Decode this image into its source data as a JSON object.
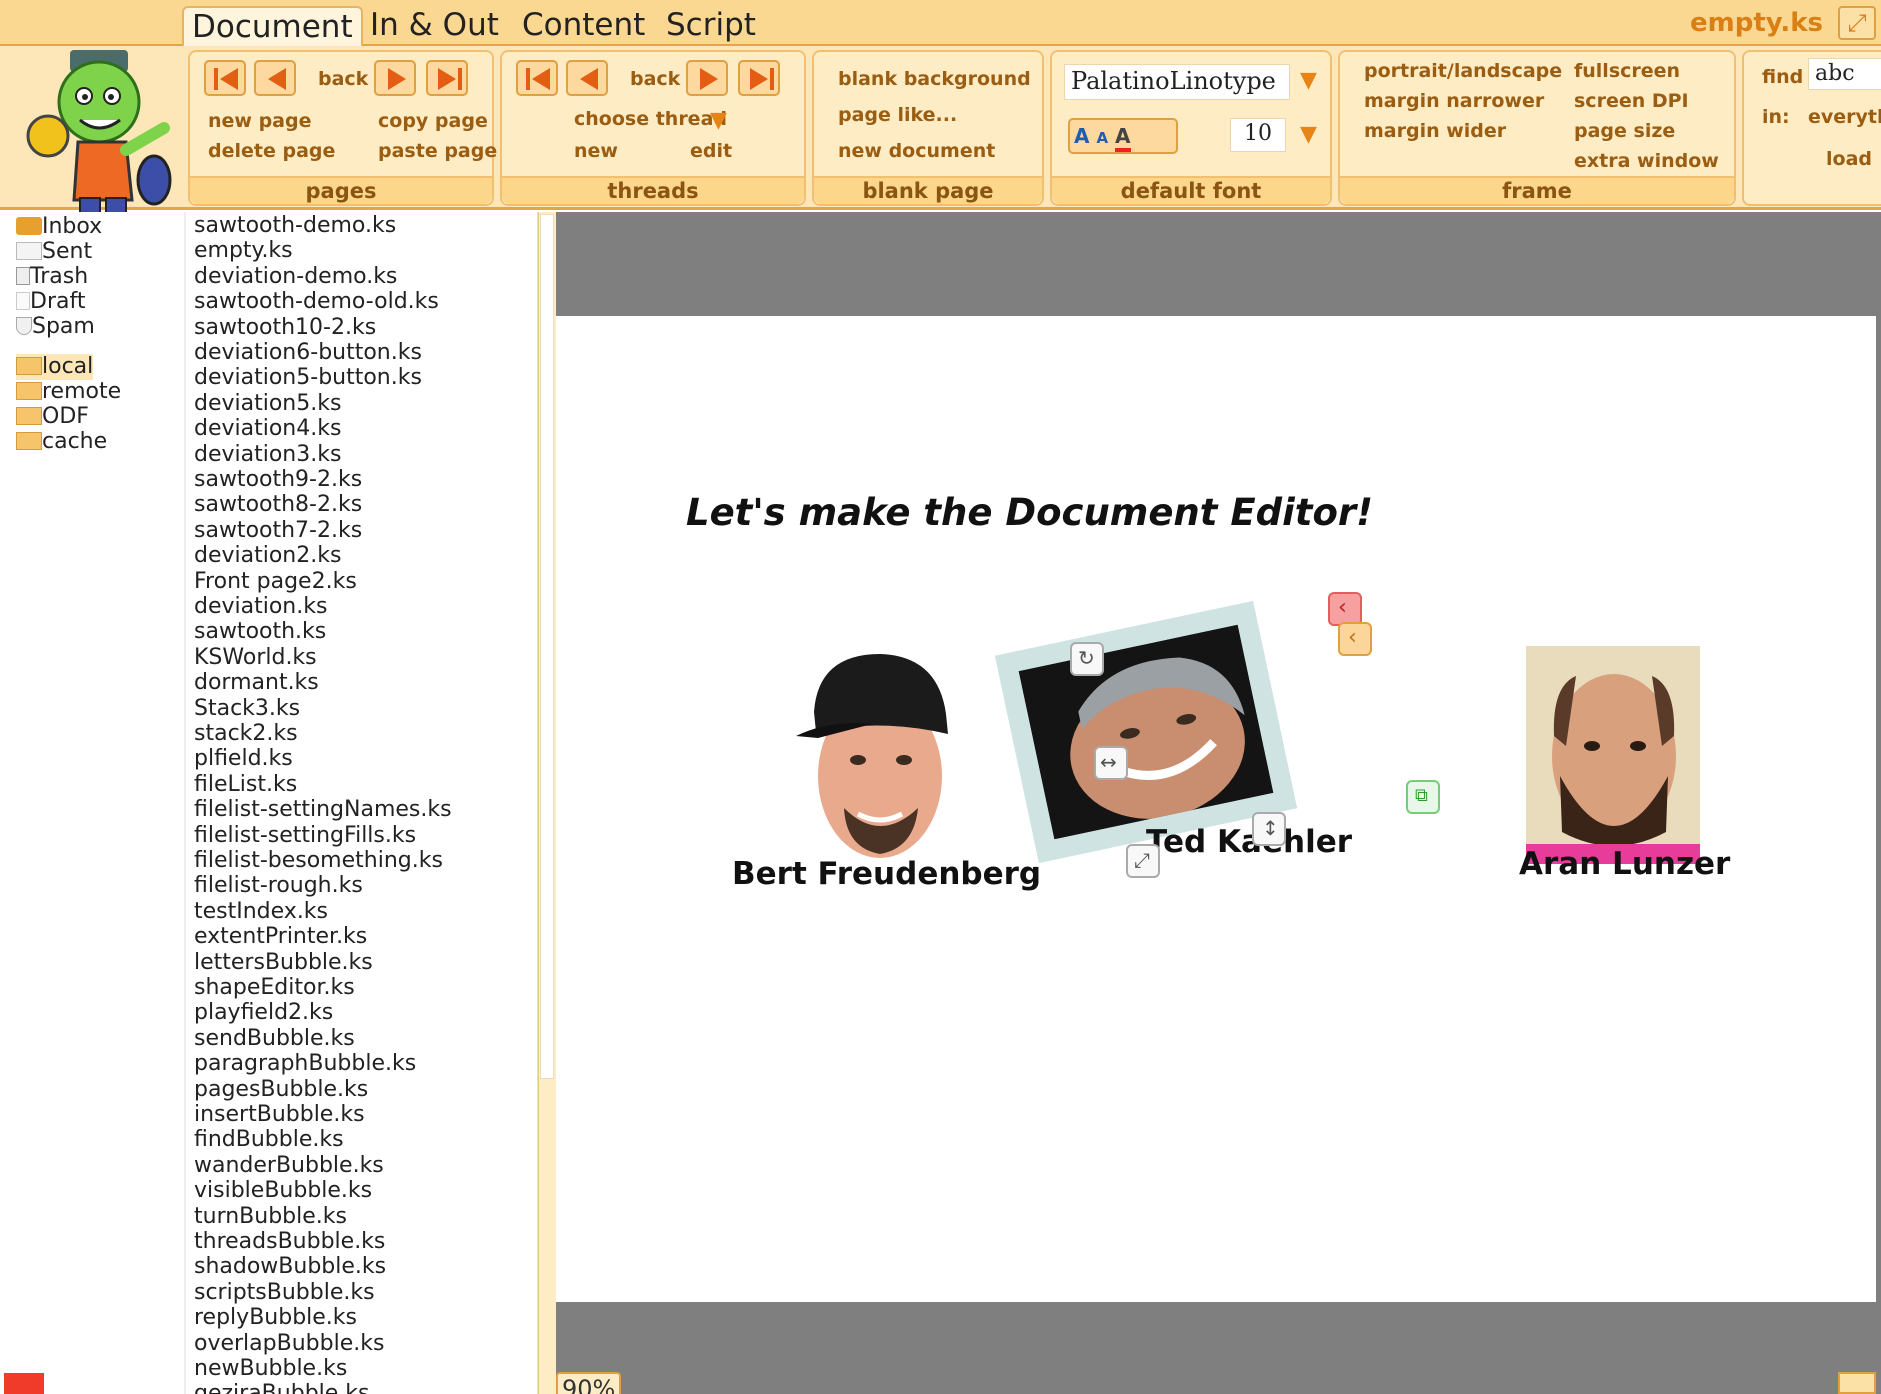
{
  "tabs": {
    "document": "Document",
    "inout": "In & Out",
    "content": "Content",
    "script": "Script"
  },
  "doc_title": "empty.ks",
  "pages_group": {
    "back": "back",
    "new_page": "new page",
    "copy_page": "copy page",
    "delete_page": "delete page",
    "paste_page": "paste page",
    "label": "pages"
  },
  "threads_group": {
    "back": "back",
    "choose_thread": "choose thread",
    "new": "new",
    "edit": "edit",
    "label": "threads"
  },
  "blank_group": {
    "blank_background": "blank background",
    "page_like": "page like...",
    "new_document": "new document",
    "label": "blank page"
  },
  "font_group": {
    "font_name": "PalatinoLinotype",
    "font_size": "10",
    "label": "default font"
  },
  "frame_group": {
    "portrait_landscape": "portrait/landscape",
    "margin_narrower": "margin narrower",
    "margin_wider": "margin wider",
    "fullscreen": "fullscreen",
    "screen_dpi": "screen DPI",
    "page_size": "page size",
    "extra_window": "extra window",
    "label": "frame"
  },
  "find_group": {
    "find": "find",
    "find_value": "abc",
    "in": "in:",
    "scope": "everyth",
    "load": "load"
  },
  "mailboxes": [
    "Inbox",
    "Sent",
    "Trash",
    "Draft",
    "Spam"
  ],
  "folders": [
    "local",
    "remote",
    "ODF",
    "cache"
  ],
  "files": [
    "sawtooth-demo.ks",
    "empty.ks",
    "deviation-demo.ks",
    "sawtooth-demo-old.ks",
    "sawtooth10-2.ks",
    "deviation6-button.ks",
    "deviation5-button.ks",
    "deviation5.ks",
    "deviation4.ks",
    "deviation3.ks",
    "sawtooth9-2.ks",
    "sawtooth8-2.ks",
    "sawtooth7-2.ks",
    "deviation2.ks",
    "Front page2.ks",
    "deviation.ks",
    "sawtooth.ks",
    "KSWorld.ks",
    "dormant.ks",
    "Stack3.ks",
    "stack2.ks",
    "plfield.ks",
    "fileList.ks",
    "filelist-settingNames.ks",
    "filelist-settingFills.ks",
    "filelist-besomething.ks",
    "filelist-rough.ks",
    "testIndex.ks",
    "extentPrinter.ks",
    "lettersBubble.ks",
    "shapeEditor.ks",
    "playfield2.ks",
    "sendBubble.ks",
    "paragraphBubble.ks",
    "pagesBubble.ks",
    "insertBubble.ks",
    "findBubble.ks",
    "wanderBubble.ks",
    "visibleBubble.ks",
    "turnBubble.ks",
    "threadsBubble.ks",
    "shadowBubble.ks",
    "scriptsBubble.ks",
    "replyBubble.ks",
    "overlapBubble.ks",
    "newBubble.ks",
    "geziraBubble.ks"
  ],
  "document": {
    "heading": "Let's make the Document Editor!",
    "people": [
      "Bert Freudenberg",
      "Ted Kaehler",
      "Aran Lunzer"
    ]
  },
  "zoom": "90%",
  "colors": {
    "accent": "#e88415",
    "ribbon": "#fde7b8",
    "tabbar": "#fad891",
    "canvas": "#7f7f7f"
  }
}
